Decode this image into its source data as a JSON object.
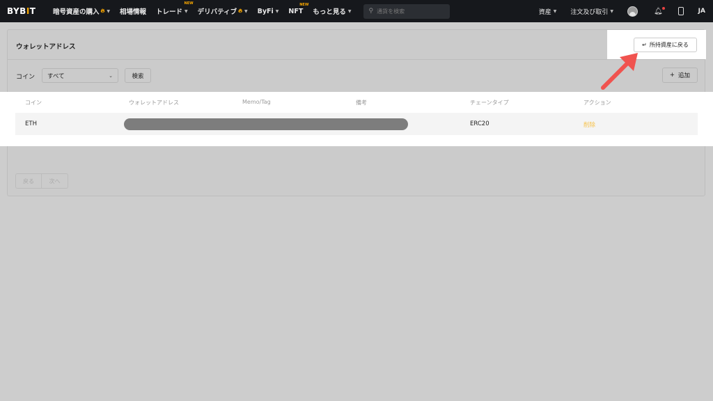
{
  "nav": {
    "logo_main": "BYB",
    "logo_mark": "I",
    "logo_tail": "T",
    "items": [
      {
        "label": "暗号資産の購入",
        "flame": true,
        "caret": true
      },
      {
        "label": "相場情報"
      },
      {
        "label": "トレード",
        "caret": true,
        "badge": "NEW"
      },
      {
        "label": "デリバティブ",
        "flame": true,
        "caret": true
      },
      {
        "label": "ByFi",
        "caret": true
      },
      {
        "label": "NFT",
        "badge": "NEW"
      },
      {
        "label": "もっと見る",
        "caret": true
      }
    ],
    "search_placeholder": "通貨を検索",
    "right_items": [
      "資産",
      "注文及び取引"
    ],
    "lang": "JA"
  },
  "page": {
    "title": "ウォレットアドレス",
    "back_button": "所持資産に戻る",
    "filter_label": "コイン",
    "coin_select_value": "すべて",
    "search_button": "検索",
    "add_button": "追加"
  },
  "table": {
    "headers": [
      "コイン",
      "ウォレットアドレス",
      "Memo/Tag",
      "備考",
      "チェーンタイプ",
      "アクション"
    ],
    "rows": [
      {
        "coin": "ETH",
        "address": "",
        "memo": "",
        "note": "",
        "chain": "ERC20",
        "action": "削除"
      }
    ]
  },
  "pagination": {
    "prev": "戻る",
    "next": "次へ"
  },
  "colors": {
    "accent": "#f7a600",
    "arrow": "#f0534f",
    "nav_bg": "#16181c"
  }
}
